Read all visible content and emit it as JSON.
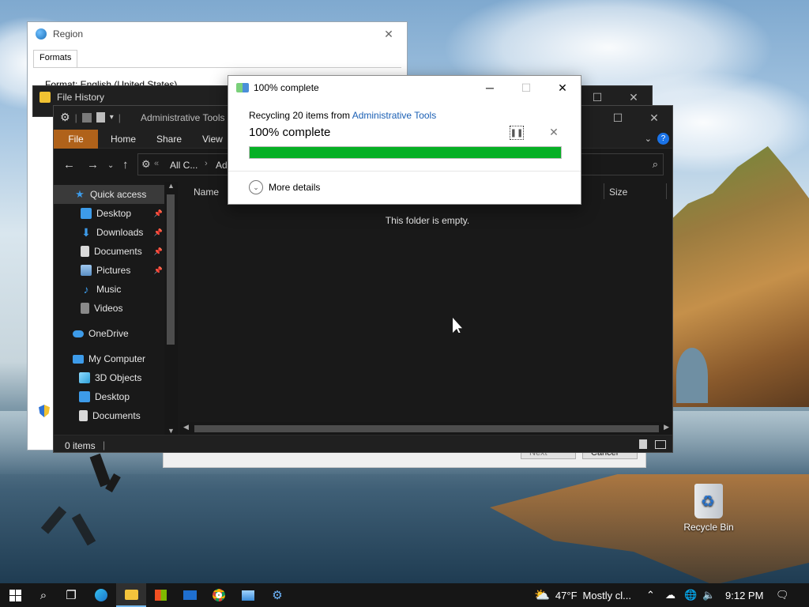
{
  "region_window": {
    "title": "Region",
    "tab": "Formats",
    "format_line": "Format: English (United States)"
  },
  "file_history": {
    "title": "File History"
  },
  "wizard": {
    "next_label": "Next",
    "cancel_label": "Cancel"
  },
  "explorer": {
    "title": "Administrative Tools",
    "ribbon_tabs": [
      "File",
      "Home",
      "Share",
      "View"
    ],
    "address_crumbs": [
      "All C...",
      "Ad"
    ],
    "columns": {
      "name": "Name",
      "size": "Size"
    },
    "empty_message": "This folder is empty.",
    "status": "0 items",
    "nav": [
      {
        "label": "Quick access",
        "icon": "star-icon",
        "pinned": false,
        "selected": true
      },
      {
        "label": "Desktop",
        "icon": "desktop-icon",
        "pinned": true
      },
      {
        "label": "Downloads",
        "icon": "download-icon",
        "pinned": true
      },
      {
        "label": "Documents",
        "icon": "document-icon",
        "pinned": true
      },
      {
        "label": "Pictures",
        "icon": "picture-icon",
        "pinned": true
      },
      {
        "label": "Music",
        "icon": "music-icon",
        "pinned": false
      },
      {
        "label": "Videos",
        "icon": "video-icon",
        "pinned": false
      },
      {
        "label": "OneDrive",
        "icon": "cloud-icon",
        "pinned": false
      },
      {
        "label": "My Computer",
        "icon": "computer-icon",
        "pinned": false
      },
      {
        "label": "3D Objects",
        "icon": "cube-icon",
        "pinned": false
      },
      {
        "label": "Desktop",
        "icon": "desktop-icon",
        "pinned": false
      },
      {
        "label": "Documents",
        "icon": "document-icon",
        "pinned": false
      }
    ]
  },
  "progress_dialog": {
    "title": "100% complete",
    "line_prefix": "Recycling 20 items from",
    "line_link": "Administrative Tools",
    "big_status": "100% complete",
    "progress_percent": 100,
    "more_details": "More details",
    "bar_color": "#06b025"
  },
  "desktop_icons": [
    {
      "label": "Recycle Bin",
      "icon": "recycle-bin-icon"
    }
  ],
  "taskbar": {
    "weather_temp": "47°F",
    "weather_text": "Mostly cl...",
    "time": "9:12 PM",
    "pinned_apps": [
      "start-icon",
      "search-icon",
      "task-view-icon",
      "edge-icon",
      "file-explorer-icon",
      "store-icon",
      "mail-icon",
      "chrome-icon",
      "control-panel-icon",
      "settings-app-icon"
    ]
  }
}
